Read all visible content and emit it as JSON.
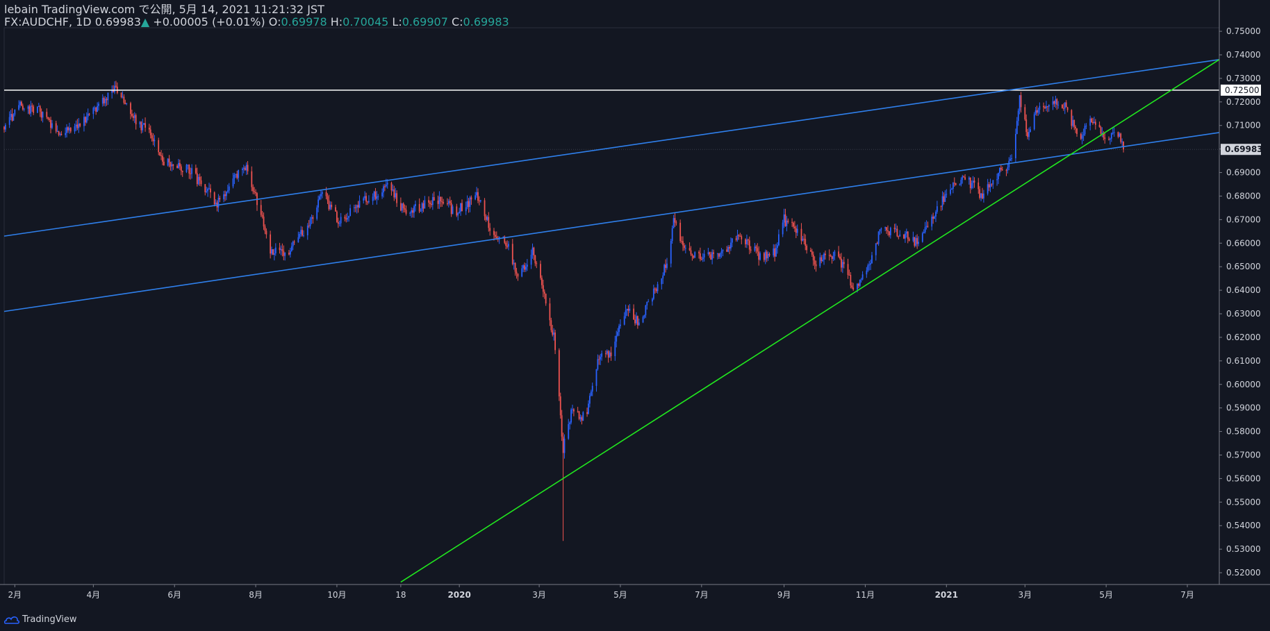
{
  "header": {
    "line1": "lebain TradingView.com で公開, 5月 14, 2021 11:21:32 JST",
    "symbol": "FX:AUDCHF, 1D",
    "last": "0.69983",
    "change": "+0.00005 (+0.01%)",
    "o_label": "O:",
    "o": "0.69978",
    "h_label": "H:",
    "h": "0.70045",
    "l_label": "L:",
    "l": "0.69907",
    "c_label": "C:",
    "c": "0.69983"
  },
  "brand": "TradingView",
  "colors": {
    "background": "#131722",
    "up": "#2962ff",
    "down": "#ef5350",
    "channel": "#2f80ed",
    "trend": "#21e81f",
    "level": "#ffffff",
    "axis_text": "#d1d4dc"
  },
  "chart_data": {
    "type": "candlestick",
    "title": "",
    "xlabel": "",
    "ylabel": "",
    "symbol": "FX:AUDCHF",
    "timeframe": "1D",
    "ylim": [
      0.515,
      0.7515
    ],
    "xlim": [
      "2019-01-24",
      "2021-07-25"
    ],
    "y_ticks": [
      "0.52000",
      "0.53000",
      "0.54000",
      "0.55000",
      "0.56000",
      "0.57000",
      "0.58000",
      "0.59000",
      "0.60000",
      "0.61000",
      "0.62000",
      "0.63000",
      "0.64000",
      "0.65000",
      "0.66000",
      "0.67000",
      "0.68000",
      "0.69000",
      "0.70000",
      "0.71000",
      "0.72000",
      "0.73000",
      "0.74000",
      "0.75000"
    ],
    "x_ticks": [
      {
        "label": "2月",
        "date": "2019-02-01",
        "bold": false
      },
      {
        "label": "4月",
        "date": "2019-04-01",
        "bold": false
      },
      {
        "label": "6月",
        "date": "2019-06-01",
        "bold": false
      },
      {
        "label": "8月",
        "date": "2019-08-01",
        "bold": false
      },
      {
        "label": "10月",
        "date": "2019-10-01",
        "bold": false
      },
      {
        "label": "18",
        "date": "2019-11-18",
        "bold": false
      },
      {
        "label": "2020",
        "date": "2020-01-01",
        "bold": true
      },
      {
        "label": "3月",
        "date": "2020-03-01",
        "bold": false
      },
      {
        "label": "5月",
        "date": "2020-05-01",
        "bold": false
      },
      {
        "label": "7月",
        "date": "2020-07-01",
        "bold": false
      },
      {
        "label": "9月",
        "date": "2020-09-01",
        "bold": false
      },
      {
        "label": "11月",
        "date": "2020-11-01",
        "bold": false
      },
      {
        "label": "2021",
        "date": "2021-01-01",
        "bold": true
      },
      {
        "label": "3月",
        "date": "2021-03-01",
        "bold": false
      },
      {
        "label": "5月",
        "date": "2021-05-01",
        "bold": false
      },
      {
        "label": "7月",
        "date": "2021-07-01",
        "bold": false
      }
    ],
    "price_path": [
      {
        "date": "2019-01-24",
        "close": 0.7095
      },
      {
        "date": "2019-02-05",
        "close": 0.718
      },
      {
        "date": "2019-02-20",
        "close": 0.716
      },
      {
        "date": "2019-03-05",
        "close": 0.706
      },
      {
        "date": "2019-03-20",
        "close": 0.71
      },
      {
        "date": "2019-04-10",
        "close": 0.722
      },
      {
        "date": "2019-04-18",
        "close": 0.7255
      },
      {
        "date": "2019-05-01",
        "close": 0.714
      },
      {
        "date": "2019-05-15",
        "close": 0.705
      },
      {
        "date": "2019-05-25",
        "close": 0.694
      },
      {
        "date": "2019-06-10",
        "close": 0.692
      },
      {
        "date": "2019-06-25",
        "close": 0.683
      },
      {
        "date": "2019-07-02",
        "close": 0.676
      },
      {
        "date": "2019-07-20",
        "close": 0.69
      },
      {
        "date": "2019-07-25",
        "close": 0.694
      },
      {
        "date": "2019-08-02",
        "close": 0.678
      },
      {
        "date": "2019-08-12",
        "close": 0.657
      },
      {
        "date": "2019-08-25",
        "close": 0.656
      },
      {
        "date": "2019-09-10",
        "close": 0.668
      },
      {
        "date": "2019-09-20",
        "close": 0.681
      },
      {
        "date": "2019-10-02",
        "close": 0.67
      },
      {
        "date": "2019-10-15",
        "close": 0.675
      },
      {
        "date": "2019-10-30",
        "close": 0.681
      },
      {
        "date": "2019-11-08",
        "close": 0.685
      },
      {
        "date": "2019-11-20",
        "close": 0.674
      },
      {
        "date": "2019-12-05",
        "close": 0.676
      },
      {
        "date": "2019-12-20",
        "close": 0.679
      },
      {
        "date": "2019-12-28",
        "close": 0.673
      },
      {
        "date": "2020-01-15",
        "close": 0.68
      },
      {
        "date": "2020-01-25",
        "close": 0.665
      },
      {
        "date": "2020-02-05",
        "close": 0.661
      },
      {
        "date": "2020-02-15",
        "close": 0.645
      },
      {
        "date": "2020-02-25",
        "close": 0.658
      },
      {
        "date": "2020-03-05",
        "close": 0.638
      },
      {
        "date": "2020-03-12",
        "close": 0.62
      },
      {
        "date": "2020-03-19",
        "close": 0.573
      },
      {
        "date": "2020-03-25",
        "close": 0.588
      },
      {
        "date": "2020-04-05",
        "close": 0.586
      },
      {
        "date": "2020-04-15",
        "close": 0.612
      },
      {
        "date": "2020-04-25",
        "close": 0.614
      },
      {
        "date": "2020-05-05",
        "close": 0.633
      },
      {
        "date": "2020-05-15",
        "close": 0.626
      },
      {
        "date": "2020-05-25",
        "close": 0.638
      },
      {
        "date": "2020-06-05",
        "close": 0.652
      },
      {
        "date": "2020-06-10",
        "close": 0.67
      },
      {
        "date": "2020-06-20",
        "close": 0.655
      },
      {
        "date": "2020-07-10",
        "close": 0.654
      },
      {
        "date": "2020-07-30",
        "close": 0.663
      },
      {
        "date": "2020-08-15",
        "close": 0.654
      },
      {
        "date": "2020-08-25",
        "close": 0.656
      },
      {
        "date": "2020-09-01",
        "close": 0.67
      },
      {
        "date": "2020-09-15",
        "close": 0.662
      },
      {
        "date": "2020-09-25",
        "close": 0.652
      },
      {
        "date": "2020-10-10",
        "close": 0.656
      },
      {
        "date": "2020-10-25",
        "close": 0.64
      },
      {
        "date": "2020-11-05",
        "close": 0.653
      },
      {
        "date": "2020-11-12",
        "close": 0.665
      },
      {
        "date": "2020-11-28",
        "close": 0.665
      },
      {
        "date": "2020-12-10",
        "close": 0.66
      },
      {
        "date": "2020-12-20",
        "close": 0.67
      },
      {
        "date": "2021-01-05",
        "close": 0.684
      },
      {
        "date": "2021-01-15",
        "close": 0.688
      },
      {
        "date": "2021-01-28",
        "close": 0.68
      },
      {
        "date": "2021-02-10",
        "close": 0.69
      },
      {
        "date": "2021-02-20",
        "close": 0.696
      },
      {
        "date": "2021-02-25",
        "close": 0.723
      },
      {
        "date": "2021-03-03",
        "close": 0.705
      },
      {
        "date": "2021-03-10",
        "close": 0.716
      },
      {
        "date": "2021-03-20",
        "close": 0.72
      },
      {
        "date": "2021-04-01",
        "close": 0.718
      },
      {
        "date": "2021-04-10",
        "close": 0.704
      },
      {
        "date": "2021-04-20",
        "close": 0.712
      },
      {
        "date": "2021-05-01",
        "close": 0.704
      },
      {
        "date": "2021-05-10",
        "close": 0.706
      },
      {
        "date": "2021-05-14",
        "close": 0.69983
      }
    ],
    "drawings": [
      {
        "kind": "horizontal",
        "name": "resistance-level",
        "price": 0.725,
        "label": "0.72500"
      },
      {
        "kind": "trendline",
        "name": "channel-upper",
        "p1": {
          "date": "2019-01-24",
          "price": 0.663
        },
        "p2": {
          "date": "2021-07-25",
          "price": 0.738
        }
      },
      {
        "kind": "trendline",
        "name": "channel-lower",
        "p1": {
          "date": "2019-01-24",
          "price": 0.631
        },
        "p2": {
          "date": "2021-07-25",
          "price": 0.707
        }
      },
      {
        "kind": "trendline",
        "name": "uptrend-line",
        "p1": {
          "date": "2019-11-18",
          "price": 0.516
        },
        "p2": {
          "date": "2021-07-25",
          "price": 0.738
        }
      }
    ],
    "last_price_label": "0.69983"
  }
}
